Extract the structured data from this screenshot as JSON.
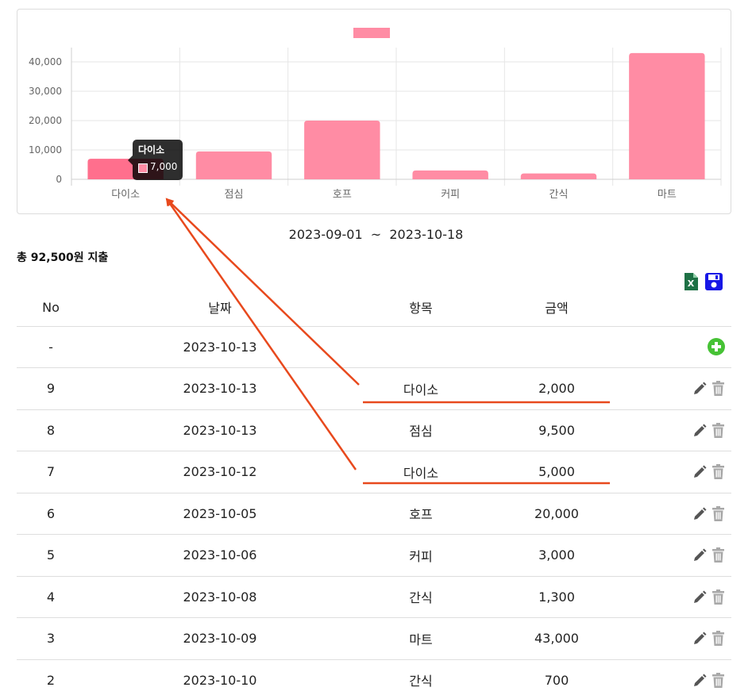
{
  "chart_data": {
    "type": "bar",
    "categories": [
      "다이소",
      "점심",
      "호프",
      "커피",
      "간식",
      "마트"
    ],
    "values": [
      7000,
      9500,
      20000,
      3000,
      2000,
      43000
    ],
    "ylim": [
      0,
      45000
    ],
    "y_ticks": [
      "0",
      "10,000",
      "20,000",
      "30,000",
      "40,000"
    ],
    "y_tick_values": [
      0,
      10000,
      20000,
      30000,
      40000
    ],
    "legend": "top-center",
    "grid": true,
    "bar_color": "#ff8ca4",
    "highlight_color": "#ff6f8d",
    "tooltip": {
      "title": "다이소",
      "value": "7,000"
    }
  },
  "summary": {
    "date_from": "2023-09-01",
    "date_sep": "~",
    "date_to": "2023-10-18",
    "total_prefix": "총",
    "total_amount": "92,500원",
    "total_suffix": "지출"
  },
  "toolbar": {
    "excel_icon": "excel-file-icon",
    "save_icon": "floppy-disk-icon"
  },
  "table": {
    "headers": {
      "no": "No",
      "date": "날짜",
      "item": "항목",
      "amount": "금액"
    },
    "new_row": {
      "no": "-",
      "date": "2023-10-13"
    },
    "rows": [
      {
        "no": "9",
        "date": "2023-10-13",
        "item": "다이소",
        "amount": "2,000"
      },
      {
        "no": "8",
        "date": "2023-10-13",
        "item": "점심",
        "amount": "9,500"
      },
      {
        "no": "7",
        "date": "2023-10-12",
        "item": "다이소",
        "amount": "5,000"
      },
      {
        "no": "6",
        "date": "2023-10-05",
        "item": "호프",
        "amount": "20,000"
      },
      {
        "no": "5",
        "date": "2023-10-06",
        "item": "커피",
        "amount": "3,000"
      },
      {
        "no": "4",
        "date": "2023-10-08",
        "item": "간식",
        "amount": "1,300"
      },
      {
        "no": "3",
        "date": "2023-10-09",
        "item": "마트",
        "amount": "43,000"
      },
      {
        "no": "2",
        "date": "2023-10-10",
        "item": "간식",
        "amount": "700"
      }
    ]
  },
  "annotation_color": "#e8491d"
}
